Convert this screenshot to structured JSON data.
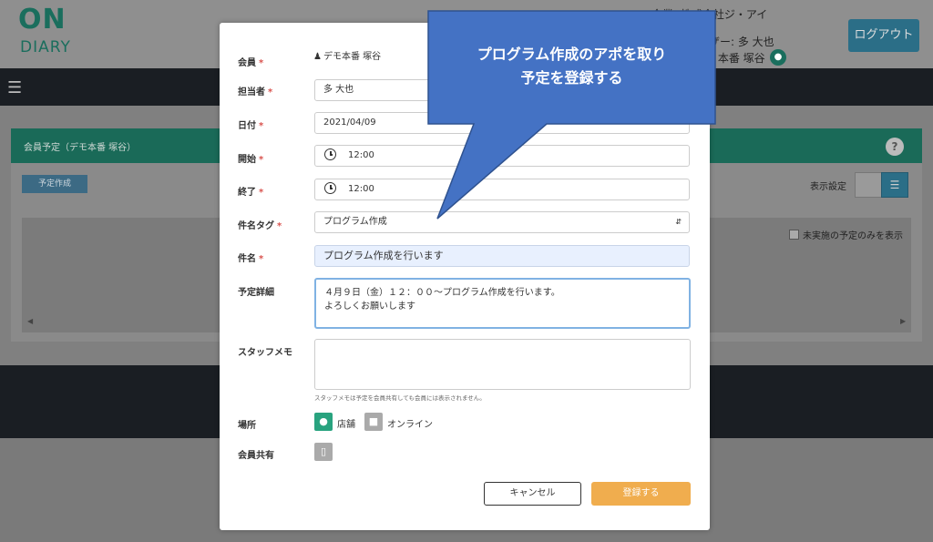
{
  "header": {
    "logo_on": "ON",
    "logo_diary": "DIARY",
    "company": "企業: 株式会社ジ・アイ",
    "staff": "ザー: 多 大也",
    "member": ": 本番 塚谷",
    "logout": "ログアウト"
  },
  "page": {
    "card_title": "会員予定（デモ本番 塚谷）",
    "create_button": "予定作成",
    "display_setting": "表示設定",
    "unfinished_only": "未実施の予定のみを表示",
    "help": "?"
  },
  "modal": {
    "member": {
      "label": "会員",
      "value": "デモ本番 塚谷"
    },
    "staff": {
      "label": "担当者",
      "value": "多 大也"
    },
    "date": {
      "label": "日付",
      "value": "2021/04/09"
    },
    "start": {
      "label": "開始",
      "value": "12:00"
    },
    "end": {
      "label": "終了",
      "value": "12:00"
    },
    "tag": {
      "label": "件名タグ",
      "value": "プログラム作成"
    },
    "subject": {
      "label": "件名",
      "value": "プログラム作成を行います"
    },
    "detail": {
      "label": "予定詳細",
      "value": "４月９日（金）１２：００〜プログラム作成を行います。\nよろしくお願いします"
    },
    "staff_memo": {
      "label": "スタッフメモ",
      "value": "",
      "hint": "スタッフメモは予定を会員共有しても会員には表示されません。"
    },
    "location": {
      "label": "場所",
      "store": "店舗",
      "online": "オンライン"
    },
    "share": {
      "label": "会員共有"
    },
    "cancel": "キャンセル",
    "register": "登録する",
    "required_mark": "*"
  },
  "callout": {
    "line1": "プログラム作成のアポを取り",
    "line2": "予定を登録する"
  },
  "colors": {
    "brand_green": "#1a6e5d",
    "register_orange": "#f0ad4e",
    "callout_blue": "#4472c4"
  }
}
